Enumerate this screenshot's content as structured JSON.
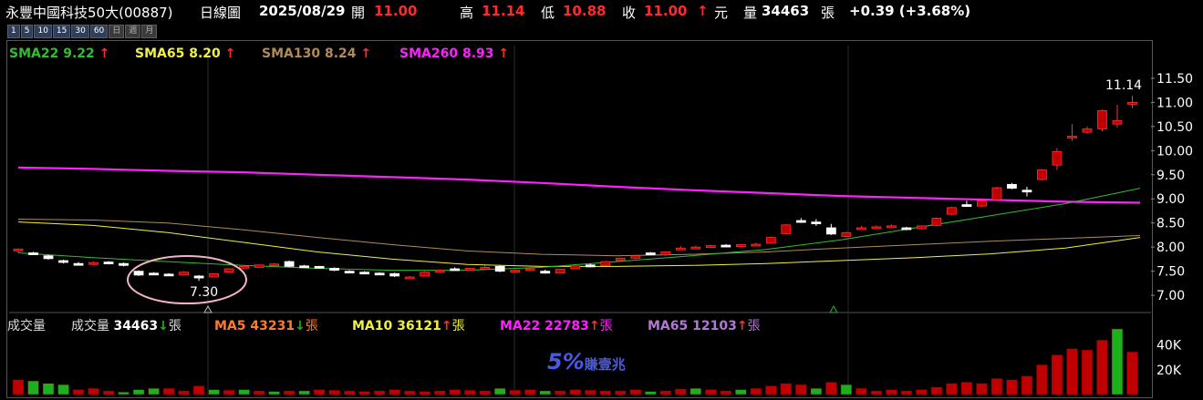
{
  "header": {
    "name": "永豐中國科技50大(00887)",
    "period": "日線圖",
    "date": "2025/08/29",
    "open_label": "開",
    "open": "11.00",
    "high_label": "高",
    "high": "11.14",
    "low_label": "低",
    "low": "10.88",
    "close_label": "收",
    "close": "11.00",
    "arrow": "↑",
    "unit": "元",
    "volume_label": "量",
    "volume": "34463",
    "volume_unit": "張",
    "change": "+0.39 (+3.68%)"
  },
  "periods": [
    "1",
    "5",
    "10",
    "15",
    "30",
    "60",
    "日",
    "週",
    "月"
  ],
  "legend": {
    "sma22": "SMA22 9.22",
    "sma65": "SMA65 8.20",
    "sma130": "SMA130 8.24",
    "sma260": "SMA260 8.93",
    "up": "↑"
  },
  "vol_legend": {
    "title": "成交量",
    "vol": "成交量",
    "vol_val": "34463",
    "zhang": "張",
    "ma5": "MA5 43231",
    "ma10": "MA10 36121",
    "ma22": "MA22 22783",
    "ma65": "MA65 12103",
    "down": "↓",
    "up": "↑"
  },
  "watermark": {
    "big": "5%",
    "small": "賺壹兆"
  },
  "colors": {
    "up": "#c00000",
    "down": "#ffffff",
    "vol_up": "#c00000",
    "vol_down": "#1cb11c",
    "sma22": "#2fbf2f",
    "sma65": "#f0f040",
    "sma130": "#b08a5a",
    "sma260": "#ff20ff"
  },
  "chart_data": {
    "type": "candlestick",
    "y_ticks": [
      "7.00",
      "7.50",
      "8.00",
      "8.50",
      "9.00",
      "9.50",
      "10.00",
      "10.50",
      "11.00",
      "11.50"
    ],
    "ylim": [
      6.7,
      11.8
    ],
    "vol_ticks": [
      "20K",
      "40K"
    ],
    "vol_ylim": [
      0,
      50000
    ],
    "annotations": {
      "low_label": "7.30",
      "high_label": "11.14"
    },
    "candles": [
      [
        7.92,
        7.97,
        7.88,
        7.96
      ],
      [
        7.88,
        7.9,
        7.84,
        7.86
      ],
      [
        7.82,
        7.84,
        7.74,
        7.76
      ],
      [
        7.72,
        7.74,
        7.66,
        7.69
      ],
      [
        7.66,
        7.69,
        7.63,
        7.65
      ],
      [
        7.64,
        7.7,
        7.62,
        7.68
      ],
      [
        7.69,
        7.71,
        7.64,
        7.66
      ],
      [
        7.66,
        7.68,
        7.6,
        7.62
      ],
      [
        7.5,
        7.52,
        7.4,
        7.42
      ],
      [
        7.46,
        7.48,
        7.42,
        7.44
      ],
      [
        7.44,
        7.46,
        7.41,
        7.43
      ],
      [
        7.42,
        7.5,
        7.41,
        7.48
      ],
      [
        7.4,
        7.42,
        7.3,
        7.36
      ],
      [
        7.38,
        7.46,
        7.37,
        7.45
      ],
      [
        7.48,
        7.56,
        7.47,
        7.55
      ],
      [
        7.6,
        7.62,
        7.58,
        7.6
      ],
      [
        7.58,
        7.64,
        7.57,
        7.63
      ],
      [
        7.62,
        7.67,
        7.61,
        7.65
      ],
      [
        7.7,
        7.72,
        7.58,
        7.6
      ],
      [
        7.61,
        7.63,
        7.59,
        7.6
      ],
      [
        7.6,
        7.61,
        7.56,
        7.57
      ],
      [
        7.56,
        7.58,
        7.5,
        7.52
      ],
      [
        7.5,
        7.52,
        7.46,
        7.48
      ],
      [
        7.48,
        7.5,
        7.45,
        7.46
      ],
      [
        7.46,
        7.48,
        7.43,
        7.45
      ],
      [
        7.45,
        7.47,
        7.38,
        7.4
      ],
      [
        7.36,
        7.4,
        7.35,
        7.38
      ],
      [
        7.4,
        7.5,
        7.39,
        7.48
      ],
      [
        7.5,
        7.54,
        7.48,
        7.52
      ],
      [
        7.55,
        7.58,
        7.52,
        7.54
      ],
      [
        7.55,
        7.57,
        7.53,
        7.56
      ],
      [
        7.57,
        7.62,
        7.54,
        7.58
      ],
      [
        7.6,
        7.62,
        7.48,
        7.5
      ],
      [
        7.49,
        7.53,
        7.47,
        7.52
      ],
      [
        7.52,
        7.56,
        7.5,
        7.55
      ],
      [
        7.5,
        7.53,
        7.45,
        7.46
      ],
      [
        7.46,
        7.55,
        7.45,
        7.54
      ],
      [
        7.55,
        7.62,
        7.54,
        7.61
      ],
      [
        7.63,
        7.66,
        7.58,
        7.59
      ],
      [
        7.62,
        7.71,
        7.61,
        7.7
      ],
      [
        7.72,
        7.78,
        7.7,
        7.77
      ],
      [
        7.77,
        7.84,
        7.75,
        7.82
      ],
      [
        7.88,
        7.9,
        7.83,
        7.84
      ],
      [
        7.84,
        7.91,
        7.82,
        7.9
      ],
      [
        7.98,
        8.02,
        7.96,
        7.98
      ],
      [
        7.98,
        8.03,
        7.96,
        8.0
      ],
      [
        8.01,
        8.05,
        7.98,
        8.03
      ],
      [
        8.04,
        8.06,
        8.01,
        8.02
      ],
      [
        8.02,
        8.06,
        8.0,
        8.05
      ],
      [
        8.05,
        8.09,
        8.03,
        8.06
      ],
      [
        8.08,
        8.22,
        8.07,
        8.2
      ],
      [
        8.28,
        8.48,
        8.27,
        8.46
      ],
      [
        8.55,
        8.6,
        8.5,
        8.52
      ],
      [
        8.52,
        8.58,
        8.44,
        8.5
      ],
      [
        8.4,
        8.48,
        8.25,
        8.27
      ],
      [
        8.22,
        8.32,
        8.2,
        8.3
      ],
      [
        8.4,
        8.44,
        8.38,
        8.4
      ],
      [
        8.41,
        8.45,
        8.39,
        8.42
      ],
      [
        8.43,
        8.47,
        8.4,
        8.44
      ],
      [
        8.4,
        8.42,
        8.35,
        8.37
      ],
      [
        8.38,
        8.45,
        8.36,
        8.44
      ],
      [
        8.45,
        8.62,
        8.44,
        8.6
      ],
      [
        8.68,
        8.84,
        8.66,
        8.82
      ],
      [
        8.88,
        8.96,
        8.85,
        8.87
      ],
      [
        8.85,
        8.98,
        8.83,
        8.96
      ],
      [
        8.98,
        9.25,
        8.97,
        9.23
      ],
      [
        9.3,
        9.33,
        9.2,
        9.22
      ],
      [
        9.18,
        9.25,
        9.05,
        9.16
      ],
      [
        9.4,
        9.62,
        9.38,
        9.6
      ],
      [
        9.7,
        10.05,
        9.6,
        9.98
      ],
      [
        10.28,
        10.55,
        10.2,
        10.3
      ],
      [
        10.38,
        10.5,
        10.35,
        10.45
      ],
      [
        10.45,
        10.85,
        10.4,
        10.83
      ],
      [
        10.55,
        10.95,
        10.48,
        10.62
      ],
      [
        11.0,
        11.14,
        10.88,
        11.0
      ]
    ],
    "volumes": [
      [
        12000,
        "up"
      ],
      [
        11000,
        "down"
      ],
      [
        9000,
        "down"
      ],
      [
        8000,
        "down"
      ],
      [
        4000,
        "up"
      ],
      [
        5000,
        "up"
      ],
      [
        3000,
        "up"
      ],
      [
        2000,
        "down"
      ],
      [
        4000,
        "down"
      ],
      [
        5000,
        "down"
      ],
      [
        5000,
        "up"
      ],
      [
        3000,
        "up"
      ],
      [
        7000,
        "up"
      ],
      [
        4000,
        "down"
      ],
      [
        3500,
        "up"
      ],
      [
        4000,
        "down"
      ],
      [
        3000,
        "up"
      ],
      [
        2500,
        "down"
      ],
      [
        3000,
        "up"
      ],
      [
        3000,
        "down"
      ],
      [
        4000,
        "up"
      ],
      [
        3500,
        "up"
      ],
      [
        3000,
        "up"
      ],
      [
        2500,
        "up"
      ],
      [
        3000,
        "up"
      ],
      [
        4000,
        "up"
      ],
      [
        3000,
        "up"
      ],
      [
        2500,
        "up"
      ],
      [
        3000,
        "up"
      ],
      [
        4000,
        "up"
      ],
      [
        3500,
        "up"
      ],
      [
        3000,
        "up"
      ],
      [
        5000,
        "down"
      ],
      [
        3500,
        "up"
      ],
      [
        4000,
        "up"
      ],
      [
        3000,
        "down"
      ],
      [
        3000,
        "up"
      ],
      [
        4000,
        "up"
      ],
      [
        3500,
        "up"
      ],
      [
        3000,
        "up"
      ],
      [
        3000,
        "up"
      ],
      [
        4000,
        "up"
      ],
      [
        2500,
        "down"
      ],
      [
        3000,
        "up"
      ],
      [
        4500,
        "up"
      ],
      [
        5000,
        "down"
      ],
      [
        4000,
        "up"
      ],
      [
        3000,
        "up"
      ],
      [
        4000,
        "down"
      ],
      [
        5000,
        "up"
      ],
      [
        7000,
        "up"
      ],
      [
        9000,
        "up"
      ],
      [
        8000,
        "up"
      ],
      [
        5000,
        "down"
      ],
      [
        10000,
        "up"
      ],
      [
        8000,
        "down"
      ],
      [
        5000,
        "up"
      ],
      [
        3000,
        "up"
      ],
      [
        4000,
        "up"
      ],
      [
        3000,
        "up"
      ],
      [
        4000,
        "up"
      ],
      [
        6000,
        "up"
      ],
      [
        9000,
        "up"
      ],
      [
        10000,
        "up"
      ],
      [
        9000,
        "up"
      ],
      [
        13000,
        "up"
      ],
      [
        12000,
        "up"
      ],
      [
        15000,
        "up"
      ],
      [
        24000,
        "up"
      ],
      [
        32000,
        "up"
      ],
      [
        37000,
        "up"
      ],
      [
        36000,
        "up"
      ],
      [
        44000,
        "up"
      ],
      [
        53000,
        "down"
      ],
      [
        34463,
        "up"
      ]
    ],
    "ma_lines": {
      "sma260": [
        9.65,
        9.62,
        9.58,
        9.55,
        9.5,
        9.45,
        9.4,
        9.33,
        9.25,
        9.18,
        9.12,
        9.06,
        9.02,
        8.98,
        8.94,
        8.92
      ],
      "sma130": [
        8.58,
        8.56,
        8.5,
        8.36,
        8.2,
        8.05,
        7.92,
        7.85,
        7.82,
        7.85,
        7.9,
        7.98,
        8.05,
        8.12,
        8.18,
        8.24
      ],
      "sma65": [
        8.52,
        8.45,
        8.3,
        8.1,
        7.9,
        7.75,
        7.64,
        7.6,
        7.6,
        7.62,
        7.66,
        7.72,
        7.78,
        7.86,
        7.98,
        8.2
      ],
      "sma22": [
        7.88,
        7.78,
        7.7,
        7.62,
        7.56,
        7.52,
        7.52,
        7.58,
        7.7,
        7.82,
        7.95,
        8.15,
        8.4,
        8.65,
        8.9,
        9.22
      ]
    }
  }
}
